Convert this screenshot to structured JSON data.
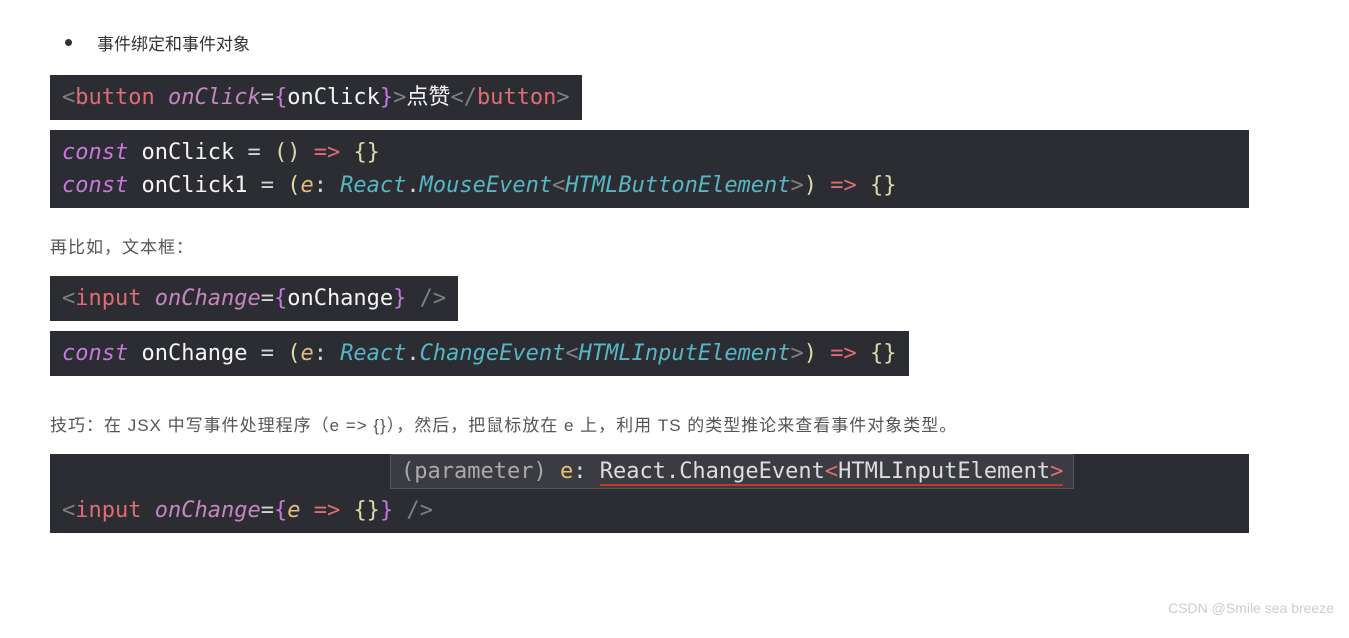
{
  "bullet_text": "事件绑定和事件对象",
  "code1": {
    "open_angle": "<",
    "tag": "button",
    "space": " ",
    "attr": "onClick",
    "eq": "=",
    "lbrace": "{",
    "ident": "onClick",
    "rbrace": "}",
    "close_angle": ">",
    "text": "点赞",
    "end_open": "</",
    "end_tag": "button",
    "end_close": ">"
  },
  "code2": {
    "l1_kw": "const",
    "l1_name": " onClick ",
    "l1_eq": "= ",
    "l1_lp": "()",
    "l1_arrow": " => ",
    "l1_body": "{}",
    "l2_kw": "const",
    "l2_name": " onClick1 ",
    "l2_eq": "= ",
    "l2_lp": "(",
    "l2_param": "e",
    "l2_colon": ": ",
    "l2_ns": "React",
    "l2_dot": ".",
    "l2_type": "MouseEvent",
    "l2_lt": "<",
    "l2_gen": "HTMLButtonElement",
    "l2_gt": ">",
    "l2_rp": ")",
    "l2_arrow": " => ",
    "l2_body": "{}"
  },
  "para2": "再比如，文本框：",
  "code3": {
    "open_angle": "<",
    "tag": "input",
    "space": " ",
    "attr": "onChange",
    "eq": "=",
    "lbrace": "{",
    "ident": "onChange",
    "rbrace": "}",
    "slash": " /",
    "close": ">"
  },
  "code4": {
    "kw": "const",
    "name": " onChange ",
    "eq": "= ",
    "lp": "(",
    "param": "e",
    "colon": ": ",
    "ns": "React",
    "dot": ".",
    "type": "ChangeEvent",
    "lt": "<",
    "gen": "HTMLInputElement",
    "gt": ">",
    "rp": ")",
    "arrow": " => ",
    "body": "{}"
  },
  "para3": "技巧：在 JSX 中写事件处理程序（e => {}），然后，把鼠标放在 e 上，利用 TS 的类型推论来查看事件对象类型。",
  "tooltip": {
    "label": "(parameter) ",
    "var": "e",
    "colon": ": ",
    "ns": "React",
    "dot": ".",
    "type": "ChangeEvent",
    "lt": "<",
    "gen": "HTMLInputElement",
    "gt": ">"
  },
  "code5": {
    "open_angle": "<",
    "tag": "input",
    "space": " ",
    "attr": "onChange",
    "eq": "=",
    "lbrace": "{",
    "param": "e",
    "arrow": " => ",
    "body": "{}",
    "rbrace": "}",
    "slash": " /",
    "close": ">"
  },
  "watermark": "CSDN @Smile sea breeze"
}
